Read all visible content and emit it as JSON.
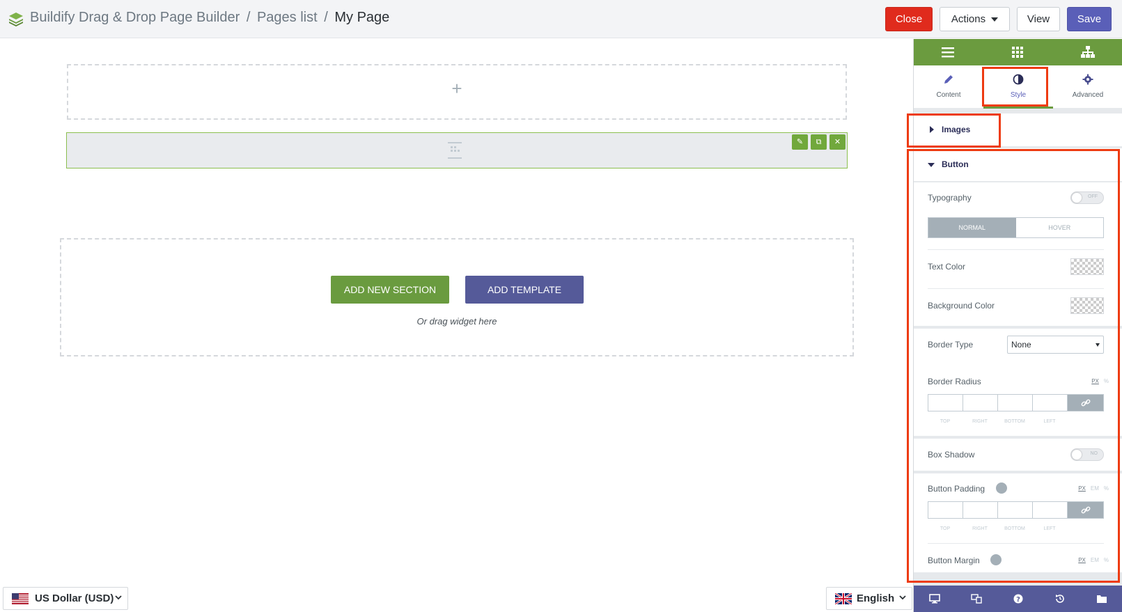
{
  "header": {
    "app_name": "Buildify Drag & Drop Page Builder",
    "sep1": "/",
    "pages_list": "Pages list",
    "sep2": "/",
    "current_page": "My Page",
    "buttons": {
      "close": "Close",
      "actions": "Actions",
      "view": "View",
      "save": "Save"
    }
  },
  "canvas": {
    "empty_plus": "+",
    "add_section": "ADD NEW SECTION",
    "add_template": "ADD TEMPLATE",
    "drag_hint": "Or drag widget here"
  },
  "footer": {
    "currency": "US Dollar (USD)",
    "language": "English"
  },
  "panel": {
    "tabs": {
      "content": "Content",
      "style": "Style",
      "advanced": "Advanced"
    },
    "sections": {
      "images": "Images",
      "button": "Button"
    },
    "controls": {
      "typography": "Typography",
      "typography_toggle": "OFF",
      "normal": "NORMAL",
      "hover": "HOVER",
      "text_color": "Text Color",
      "background_color": "Background Color",
      "border_type": "Border Type",
      "border_type_value": "None",
      "border_radius": "Border Radius",
      "unit_px": "PX",
      "unit_pct": "%",
      "unit_em": "EM",
      "dim_top": "TOP",
      "dim_right": "RIGHT",
      "dim_bottom": "BOTTOM",
      "dim_left": "LEFT",
      "box_shadow": "Box Shadow",
      "box_shadow_toggle": "NO",
      "button_padding": "Button Padding",
      "button_margin": "Button Margin"
    }
  },
  "colors": {
    "accent_green": "#6b9b3f",
    "accent_purple": "#555a99",
    "close_red": "#e02b1d",
    "highlight": "#ee3b12"
  }
}
